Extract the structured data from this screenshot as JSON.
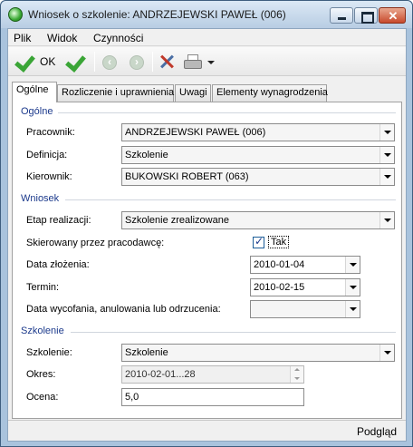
{
  "window": {
    "title": "Wniosek o szkolenie: ANDRZEJEWSKI PAWEŁ (006)",
    "close_glyph": "✕"
  },
  "menu": {
    "items": [
      {
        "label": "Plik"
      },
      {
        "label": "Widok"
      },
      {
        "label": "Czynności"
      }
    ]
  },
  "toolbar": {
    "ok_label": "OK",
    "accent_color": "#3aa536"
  },
  "tabs": [
    {
      "label": "Ogólne",
      "active": true
    },
    {
      "label": "Rozliczenie i uprawnienia",
      "active": false
    },
    {
      "label": "Uwagi",
      "active": false
    },
    {
      "label": "Elementy wynagrodzenia",
      "active": false
    }
  ],
  "groups": {
    "ogolne": {
      "title": "Ogólne",
      "pracownik_label": "Pracownik:",
      "pracownik_value": "ANDRZEJEWSKI PAWEŁ (006)",
      "definicja_label": "Definicja:",
      "definicja_value": "Szkolenie",
      "kierownik_label": "Kierownik:",
      "kierownik_value": "BUKOWSKI ROBERT (063)"
    },
    "wniosek": {
      "title": "Wniosek",
      "etap_label": "Etap realizacji:",
      "etap_value": "Szkolenie zrealizowane",
      "skierowany_label": "Skierowany przez pracodawcę:",
      "skierowany_checked": true,
      "skierowany_text": "Tak",
      "data_zlozenia_label": "Data złożenia:",
      "data_zlozenia_value": "2010-01-04",
      "termin_label": "Termin:",
      "termin_value": "2010-02-15",
      "data_wycofania_label": "Data wycofania, anulowania lub odrzucenia:",
      "data_wycofania_value": ""
    },
    "szkolenie": {
      "title": "Szkolenie",
      "szkolenie_label": "Szkolenie:",
      "szkolenie_value": "Szkolenie",
      "okres_label": "Okres:",
      "okres_value": "2010-02-01...28",
      "ocena_label": "Ocena:",
      "ocena_value": "5,0"
    }
  },
  "status": {
    "text": "Podgląd"
  }
}
